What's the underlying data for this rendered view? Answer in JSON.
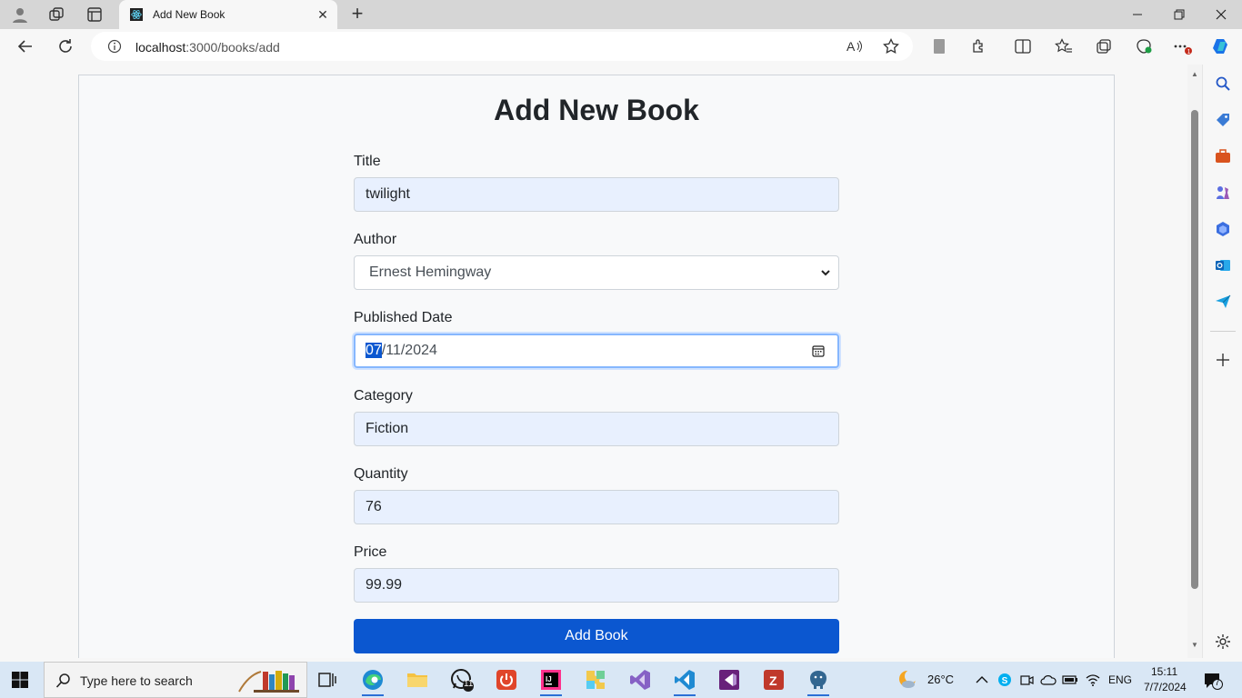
{
  "browser": {
    "tab_title": "Add New Book",
    "url_host": "localhost",
    "url_path": ":3000/books/add"
  },
  "page": {
    "title": "Add New Book",
    "fields": {
      "title": {
        "label": "Title",
        "value": "twilight"
      },
      "author": {
        "label": "Author",
        "value": "Ernest Hemingway"
      },
      "published_date": {
        "label": "Published Date",
        "month": "07",
        "rest": "/11/2024"
      },
      "category": {
        "label": "Category",
        "value": "Fiction"
      },
      "quantity": {
        "label": "Quantity",
        "value": "76"
      },
      "price": {
        "label": "Price",
        "value": "99.99"
      }
    },
    "submit_label": "Add Book"
  },
  "taskbar": {
    "search_placeholder": "Type here to search",
    "whatsapp_badge": "11",
    "weather": "26°C",
    "language": "ENG",
    "time": "15:11",
    "date": "7/7/2024",
    "notification_count": "7"
  },
  "colors": {
    "accent": "#0b57d0",
    "autofill_bg": "#e8f0fe"
  }
}
